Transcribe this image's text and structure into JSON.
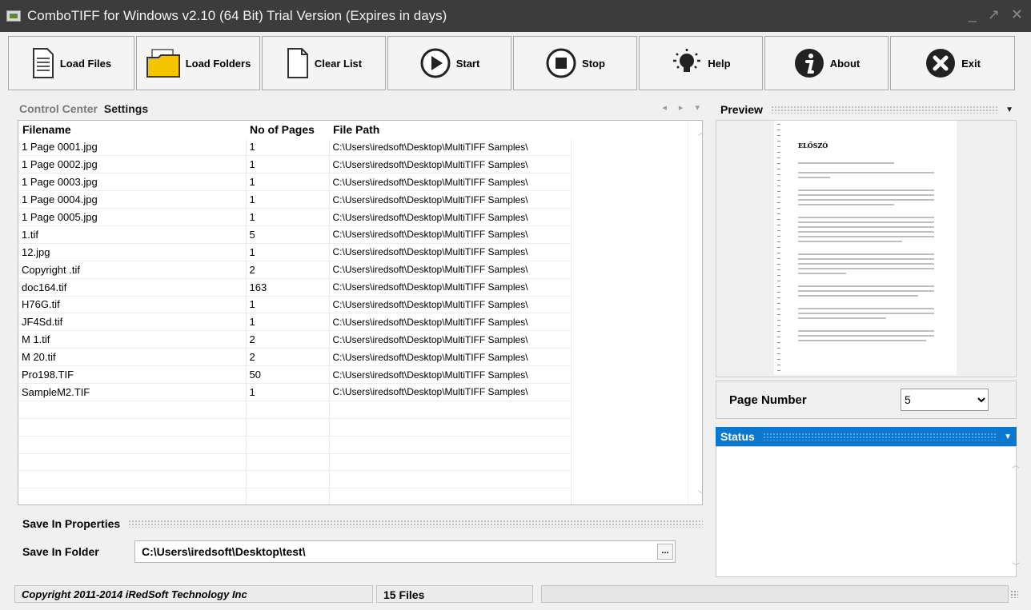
{
  "window": {
    "title": "ComboTIFF for Windows v2.10 (64 Bit)  Trial Version (Expires in days)"
  },
  "toolbar": [
    {
      "label": "Load Files",
      "icon": "document-icon"
    },
    {
      "label": "Load Folders",
      "icon": "folder-icon"
    },
    {
      "label": "Clear List",
      "icon": "blank-page-icon"
    },
    {
      "label": "Start",
      "icon": "play-icon"
    },
    {
      "label": "Stop",
      "icon": "stop-icon"
    },
    {
      "label": "Help",
      "icon": "lightbulb-icon"
    },
    {
      "label": "About",
      "icon": "info-icon"
    },
    {
      "label": "Exit",
      "icon": "close-icon"
    }
  ],
  "tabs": {
    "control_center": "Control Center",
    "settings": "Settings"
  },
  "file_table": {
    "columns": [
      "Filename",
      "No of Pages",
      "File Path"
    ],
    "rows": [
      {
        "filename": "1 Page 0001.jpg",
        "pages": "1",
        "path": "C:\\Users\\iredsoft\\Desktop\\MultiTIFF Samples\\"
      },
      {
        "filename": "1 Page 0002.jpg",
        "pages": "1",
        "path": "C:\\Users\\iredsoft\\Desktop\\MultiTIFF Samples\\"
      },
      {
        "filename": "1 Page 0003.jpg",
        "pages": "1",
        "path": "C:\\Users\\iredsoft\\Desktop\\MultiTIFF Samples\\"
      },
      {
        "filename": "1 Page 0004.jpg",
        "pages": "1",
        "path": "C:\\Users\\iredsoft\\Desktop\\MultiTIFF Samples\\"
      },
      {
        "filename": "1 Page 0005.jpg",
        "pages": "1",
        "path": "C:\\Users\\iredsoft\\Desktop\\MultiTIFF Samples\\"
      },
      {
        "filename": "1.tif",
        "pages": "5",
        "path": "C:\\Users\\iredsoft\\Desktop\\MultiTIFF Samples\\"
      },
      {
        "filename": "12.jpg",
        "pages": "1",
        "path": "C:\\Users\\iredsoft\\Desktop\\MultiTIFF Samples\\"
      },
      {
        "filename": "Copyright .tif",
        "pages": "2",
        "path": "C:\\Users\\iredsoft\\Desktop\\MultiTIFF Samples\\"
      },
      {
        "filename": "doc164.tif",
        "pages": "163",
        "path": "C:\\Users\\iredsoft\\Desktop\\MultiTIFF Samples\\"
      },
      {
        "filename": "H76G.tif",
        "pages": "1",
        "path": "C:\\Users\\iredsoft\\Desktop\\MultiTIFF Samples\\"
      },
      {
        "filename": "JF4Sd.tif",
        "pages": "1",
        "path": "C:\\Users\\iredsoft\\Desktop\\MultiTIFF Samples\\"
      },
      {
        "filename": "M 1.tif",
        "pages": "2",
        "path": "C:\\Users\\iredsoft\\Desktop\\MultiTIFF Samples\\"
      },
      {
        "filename": "M 20.tif",
        "pages": "2",
        "path": "C:\\Users\\iredsoft\\Desktop\\MultiTIFF Samples\\"
      },
      {
        "filename": "Pro198.TIF",
        "pages": "50",
        "path": "C:\\Users\\iredsoft\\Desktop\\MultiTIFF Samples\\"
      },
      {
        "filename": "SampleM2.TIF",
        "pages": "1",
        "path": "C:\\Users\\iredsoft\\Desktop\\MultiTIFF Samples\\"
      }
    ]
  },
  "save_in": {
    "section_title": "Save In Properties",
    "label": "Save In Folder",
    "value": "C:\\Users\\iredsoft\\Desktop\\test\\",
    "browse_label": "..."
  },
  "preview": {
    "title": "Preview",
    "page_heading": "ELŐSZÓ",
    "page_number_label": "Page Number",
    "page_number_value": "5"
  },
  "status": {
    "title": "Status"
  },
  "statusbar": {
    "copyright": "Copyright 2011-2014 iRedSoft Technology Inc",
    "file_count": "15 Files"
  },
  "colors": {
    "accent": "#0b78d0",
    "titlebar": "#3c3c3c"
  }
}
